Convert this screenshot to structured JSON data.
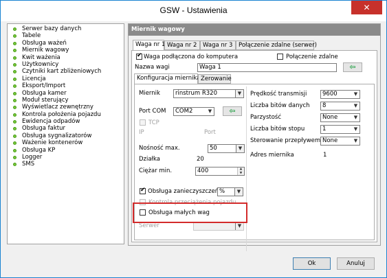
{
  "window": {
    "title": "GSW - Ustawienia",
    "close_glyph": "✕"
  },
  "sidebar": {
    "items": [
      "Serwer bazy danych",
      "Tabele",
      "Obsługa ważeń",
      "Miernik wagowy",
      "Kwit ważenia",
      "Użytkownicy",
      "Czytniki kart zbliżeniowych",
      "Licencja",
      "Eksport/Import",
      "Obsługa kamer",
      "Moduł sterujący",
      "Wyświetlacz zewnętrzny",
      "Kontrola położenia pojazdu",
      "Ewidencja odpadów",
      "Obsługa faktur",
      "Obsługa sygnalizatorów",
      "Ważenie kontenerów",
      "Obsługa KP",
      "Logger",
      "SMS"
    ]
  },
  "main": {
    "header": "Miernik wagowy",
    "tabs": [
      "Waga nr 1",
      "Waga nr 2",
      "Waga nr 3",
      "Połączenie zdalne (serwer)"
    ],
    "waga_podlaczona_label": "Waga podłączona do komputera",
    "waga_podlaczona_checked": true,
    "polaczenie_zdalne_label": "Połączenie zdalne",
    "polaczenie_zdalne_checked": false,
    "nazwa_wagi_label": "Nazwa wagi",
    "nazwa_wagi_value": "Waga 1",
    "subtabs": [
      "Konfiguracja miernika",
      "Zerowanie"
    ],
    "left": {
      "miernik_label": "Miernik",
      "miernik_value": "rinstrum R320",
      "port_com_label": "Port COM",
      "port_com_value": "COM2",
      "tcp_label": "TCP",
      "ip_label": "IP",
      "port_label": "Port",
      "nosnosc_label": "Nośność max.",
      "nosnosc_value": "50",
      "dzialka_label": "Działka",
      "dzialka_value": "20",
      "ciezar_label": "Ciężar min.",
      "ciezar_value": "400",
      "zanieczyszczen_label": "Obsługa zanieczyszczeń",
      "zanieczyszczen_checked": true,
      "zanieczyszczen_value": "%",
      "kontrola_label": "Kontrola przeciążenia pojazdu",
      "male_wagi_label": "Obsługa małych wag",
      "serwer_label": "Serwer",
      "serwer_value": ""
    },
    "right": {
      "predkosc_label": "Prędkość transmisji",
      "predkosc_value": "9600",
      "bity_danych_label": "Liczba bitów danych",
      "bity_danych_value": "8",
      "parzystosc_label": "Parzystość",
      "parzystosc_value": "None",
      "bity_stopu_label": "Liczba bitów stopu",
      "bity_stopu_value": "1",
      "sterowanie_label": "Sterowanie przepływem",
      "sterowanie_value": "None",
      "adres_label": "Adres miernika",
      "adres_value": "1"
    }
  },
  "footer": {
    "ok": "Ok",
    "cancel": "Anuluj"
  },
  "icons": {
    "arrow": "⇦",
    "combo_arrow": "▼",
    "spin_up": "▲",
    "spin_down": "▼",
    "check": "✔"
  },
  "colors": {
    "highlight_border": "#d32a2a",
    "green_arrow": "#2aa34a",
    "bullet": "#78c83a"
  }
}
